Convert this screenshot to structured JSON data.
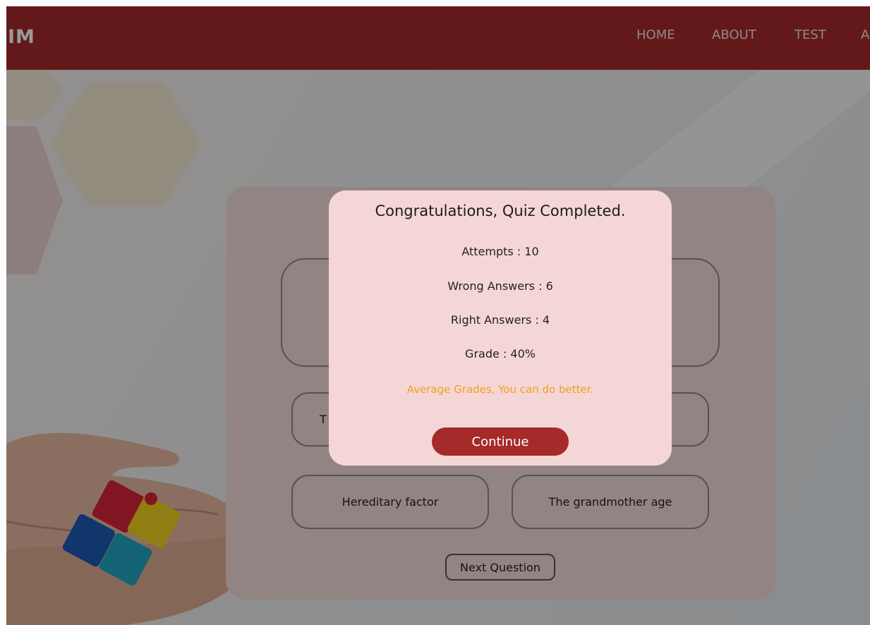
{
  "navbar": {
    "brand": "IM",
    "links": [
      "HOME",
      "ABOUT",
      "TEST",
      "A"
    ]
  },
  "quiz": {
    "question": "",
    "options": [
      "T",
      "",
      "Hereditary factor",
      "The grandmother age"
    ],
    "next_label": "Next Question"
  },
  "modal": {
    "title": "Congratulations, Quiz Completed.",
    "attempts": "Attempts : 10",
    "wrong": "Wrong Answers : 6",
    "right": "Right Answers : 4",
    "grade": "Grade : 40%",
    "message": "Average Grades, You can do better.",
    "continue_label": "Continue"
  },
  "colors": {
    "navbar": "#a52a2a",
    "button": "#a52a2a",
    "modal_bg": "#f5d6d7",
    "card_bg": "#f5dcdc",
    "message": "#f0a020"
  },
  "icons": {
    "illustration": "hands-puzzle-icon"
  }
}
